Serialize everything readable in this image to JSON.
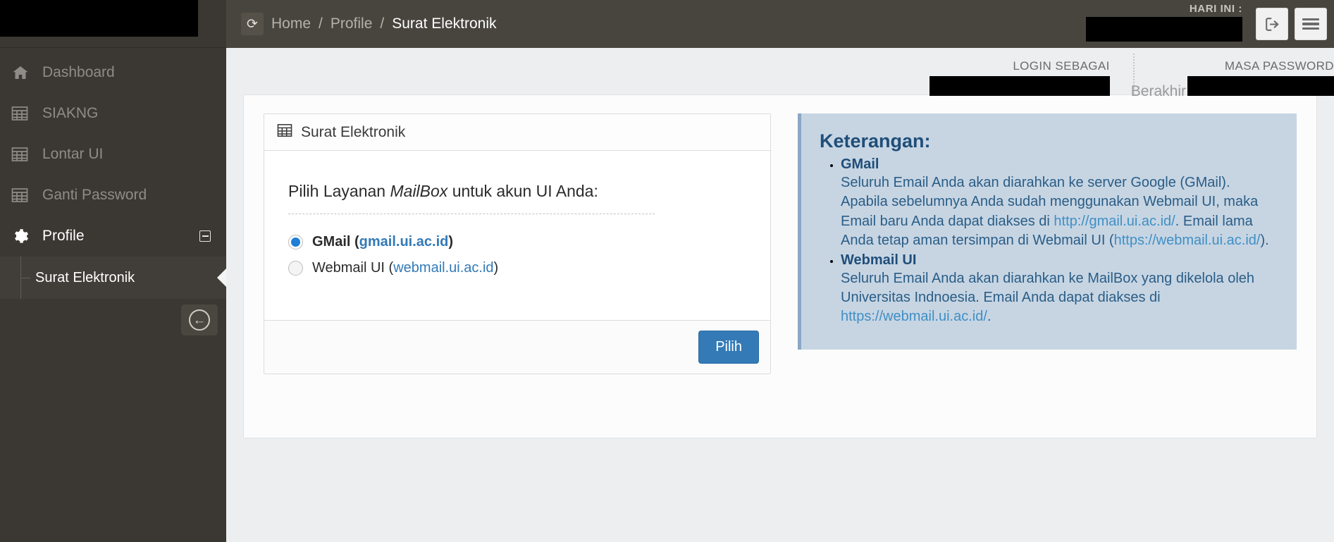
{
  "sidebar": {
    "logo_redacted": true,
    "items": [
      {
        "label": "Dashboard",
        "icon": "home-icon",
        "active": false
      },
      {
        "label": "SIAKNG",
        "icon": "table-icon",
        "active": false
      },
      {
        "label": "Lontar UI",
        "icon": "table-icon",
        "active": false
      },
      {
        "label": "Ganti Password",
        "icon": "table-icon",
        "active": false
      },
      {
        "label": "Profile",
        "icon": "gear-icon",
        "active": true,
        "collapse_sign": "minus-icon"
      }
    ],
    "submenu": [
      {
        "label": "Surat Elektronik",
        "active": true
      }
    ],
    "toggle_icon": "circle-arrow-left-icon"
  },
  "header": {
    "refresh_icon": "refresh-icon",
    "breadcrumb": [
      {
        "label": "Home",
        "current": false
      },
      {
        "label": "Profile",
        "current": false
      },
      {
        "label": "Surat Elektronik",
        "current": true
      }
    ],
    "separator": "/",
    "hari_ini_label": "HARI INI :",
    "hari_ini_value": "",
    "logout_icon": "sign-out-icon",
    "menu_icon": "hamburger-icon"
  },
  "infobar": {
    "login_sebagai_label": "LOGIN SEBAGAI",
    "login_sebagai_value": "",
    "masa_password_label": "MASA PASSWORD",
    "masa_password_prefix": "Berakhir",
    "masa_password_value": ""
  },
  "box": {
    "title": "Surat Elektronik",
    "title_icon": "table-icon",
    "prompt_before": "Pilih Layanan ",
    "prompt_italic": "MailBox",
    "prompt_after": " untuk akun UI Anda:",
    "options": [
      {
        "name": "GMail",
        "open_paren": " (",
        "url": "gmail.ui.ac.id",
        "close_paren": ")",
        "selected": true
      },
      {
        "name": "Webmail UI",
        "open_paren": " (",
        "url": "webmail.ui.ac.id",
        "close_paren": ")",
        "selected": false
      }
    ],
    "submit_label": "Pilih"
  },
  "keterangan": {
    "title": "Keterangan:",
    "items": [
      {
        "term": "GMail",
        "desc_part1": "Seluruh Email Anda akan diarahkan ke server Google (GMail). Apabila sebelumnya Anda sudah menggunakan Webmail UI, maka Email baru Anda dapat diakses di ",
        "url1": "http://gmail.ui.ac.id/",
        "desc_part2": ". Email lama Anda tetap aman tersimpan di Webmail UI (",
        "url2": "https://webmail.ui.ac.id/",
        "desc_part3": ")."
      },
      {
        "term": "Webmail UI",
        "desc_part1": "Seluruh Email Anda akan diarahkan ke MailBox yang dikelola oleh Universitas Indnoesia. Email Anda dapat diakses di ",
        "url1": "https://webmail.ui.ac.id/",
        "desc_part2": ".",
        "url2": "",
        "desc_part3": ""
      }
    ]
  },
  "colors": {
    "sidebar_bg": "#3b3833",
    "header_bg": "#48453f",
    "content_bg": "#eceef0",
    "primary_blue": "#337ab7",
    "keterangan_bg": "#c7d5e3",
    "keterangan_border": "#8aa7c4",
    "link_blue": "#3f8fc4"
  }
}
